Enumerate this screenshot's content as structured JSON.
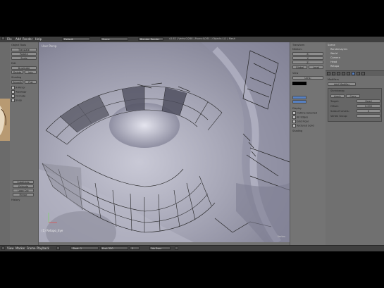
{
  "app": {
    "header": {
      "menus": [
        "File",
        "Add",
        "Render",
        "Help"
      ],
      "layout": "Default",
      "scene": "Scene",
      "engine": "Blender Render",
      "stats": "v2.62 | Verts:0/288 | Faces:0/261 | Objects:1/1 | Mesh"
    },
    "tool_shelf": {
      "panel_object_tools": "Object Tools",
      "transform": [
        "Translate",
        "Rotate",
        "Scale"
      ],
      "panel_edit": "Edit",
      "edit_buttons": [
        "Duplicate",
        "Delete",
        "Join"
      ],
      "shading": "Shading",
      "shading_buttons": [
        "Smooth",
        "Flat"
      ],
      "checks": [
        "X-Mirror",
        "Topology",
        "Occlude",
        "Snap"
      ],
      "bottom_buttons": [
        "Subdivide",
        "Extrude",
        "Loop Cut",
        "Merge"
      ],
      "history": "History"
    },
    "viewport": {
      "label": "User Persp",
      "object_name": "(1) Retopo_Eye",
      "stats_text": "Vertex"
    },
    "n_panel": {
      "title": "Transform",
      "items": [
        "Median:",
        "X:",
        "Y:",
        "Z:",
        "Global",
        "Local"
      ],
      "view": "View",
      "lens": "Lens:",
      "display": "Display",
      "display_items": [
        "Outline Selected",
        "All Edges",
        "Grid Floor",
        "Textured Solid"
      ],
      "shading": "Shading"
    },
    "outliner": {
      "items": [
        "Scene",
        "RenderLayers",
        "World",
        "Camera",
        "Head",
        "Retopo"
      ]
    },
    "properties": {
      "section": "Modifiers",
      "add_modifier": "Add Modifier",
      "modifier_name": "Shrinkwrap",
      "fields": [
        "Target:",
        "Offset:",
        "Subsurf Levels:",
        "Vertex Group:"
      ],
      "values": [
        "Head",
        "0.000",
        "0",
        ""
      ],
      "buttons": [
        "Apply",
        "Copy"
      ]
    },
    "timeline": {
      "menus": [
        "View",
        "Marker",
        "Frame",
        "Playback"
      ],
      "start": "Start: 1",
      "end": "End: 250",
      "current": "1",
      "sync": "No Sync"
    },
    "colors": {
      "background": "#727272",
      "header": "#3f3f3f",
      "accent": "#5680c2"
    }
  }
}
